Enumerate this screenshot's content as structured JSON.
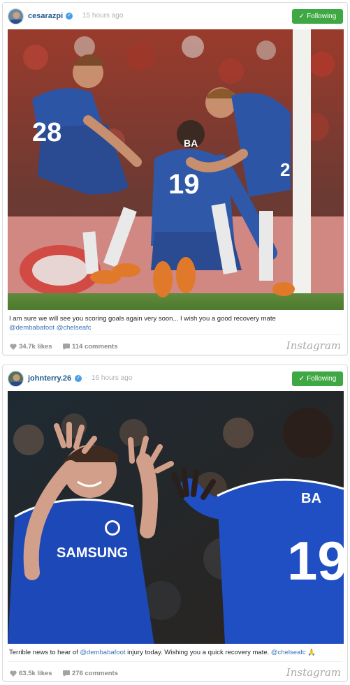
{
  "posts": [
    {
      "username": "cesarazpi",
      "timestamp": "15 hours ago",
      "follow_label": "Following",
      "caption_text": "I am sure we will see you scoring goals again very soon... I wish you a good recovery mate",
      "caption_mentions": "@dembabafoot @chelseafc",
      "likes": "34.7k likes",
      "comments": "114 comments",
      "brand": "Instagram",
      "photo_jersey_numbers": [
        "28",
        "19",
        "2"
      ],
      "photo_shirt_name": "BA"
    },
    {
      "username": "johnterry.26",
      "timestamp": "16 hours ago",
      "follow_label": "Following",
      "caption_text": "Terrible news to hear of",
      "caption_mention_1": "@dembabafoot",
      "caption_text_2": "injury today. Wishing you a quick recovery mate.",
      "caption_mention_2": "@chelseafc",
      "caption_emoji": "🙏",
      "likes": "63.5k likes",
      "comments": "276 comments",
      "brand": "Instagram",
      "photo_shirt_name": "BA",
      "photo_jersey_number": "19",
      "photo_sponsor": "SAMSUNG"
    }
  ],
  "colors": {
    "follow_button": "#3fa844",
    "username": "#1e5a8f",
    "mention": "#3b74b6",
    "verified": "#4a9ee8",
    "chelsea_blue": "#1c3f9a"
  }
}
